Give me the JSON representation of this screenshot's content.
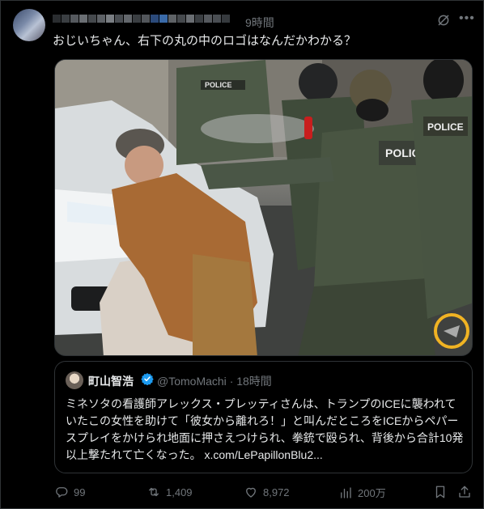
{
  "post": {
    "time": "9時間",
    "text": "おじいちゃん、右下の丸の中のロゴはなんだかわかる？"
  },
  "photo": {
    "police_patch": "POLICE"
  },
  "quote": {
    "name": "町山智浩",
    "handle": "@TomoMachi",
    "time": "· 18時間",
    "body": "ミネソタの看護師アレックス・プレッティさんは、トランプのICEに襲われていたこの女性を助けて「彼女から離れろ！」と叫んだところをICEからペパースプレイをかけられ地面に押さえつけられ、拳銃で殴られ、背後から合計10発以上撃たれて亡くなった。",
    "link": "x.com/LePapillonBlu2..."
  },
  "actions": {
    "replies": "99",
    "reposts": "1,409",
    "likes": "8,972",
    "views": "200万"
  },
  "colors": {
    "background": "#000000",
    "text": "#e7e9ea",
    "muted": "#71767b",
    "verified": "#1d9bf0",
    "highlight_circle": "#f0b323"
  }
}
